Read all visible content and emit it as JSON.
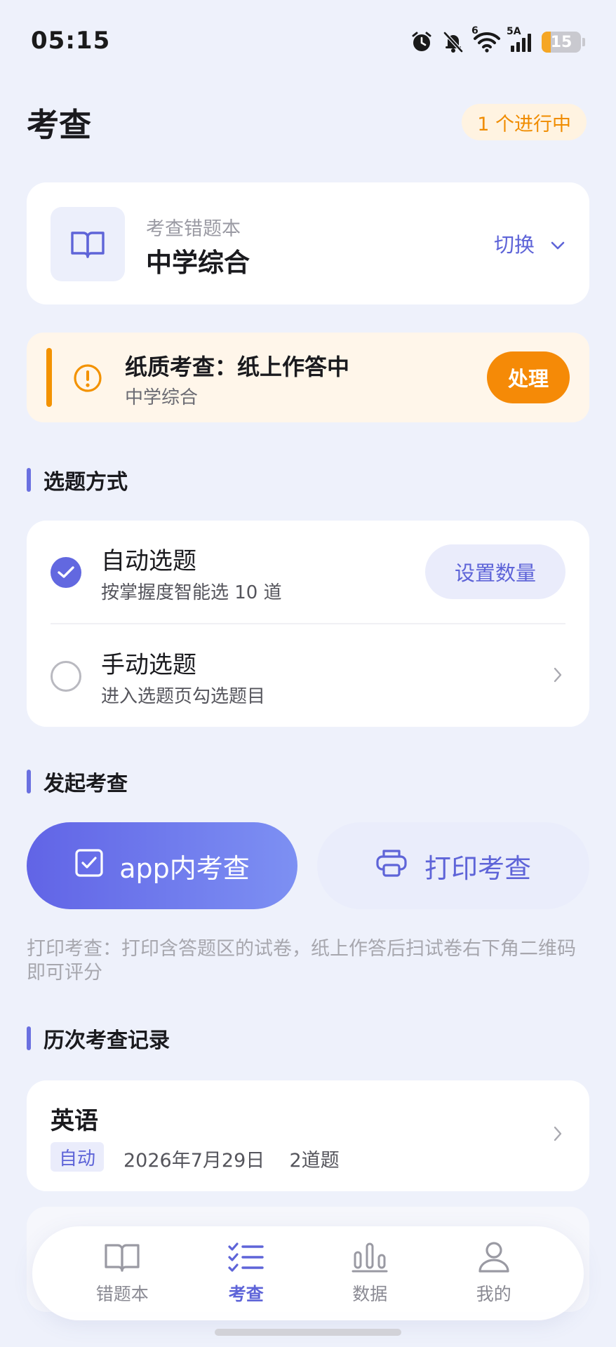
{
  "status_bar": {
    "time": "05:15",
    "network_label": "5A",
    "wifi_label": "6",
    "battery_level": "15"
  },
  "header": {
    "title": "考查",
    "progress_chip": "1 个进行中"
  },
  "notebook": {
    "subtitle": "考查错题本",
    "name": "中学综合",
    "switch_label": "切换"
  },
  "alert": {
    "title": "纸质考查：纸上作答中",
    "subtitle": "中学综合",
    "action_label": "处理"
  },
  "sections": {
    "select_mode": "选题方式",
    "launch": "发起考查",
    "history": "历次考查记录"
  },
  "select_mode": {
    "options": [
      {
        "title": "自动选题",
        "description": "按掌握度智能选 10 道",
        "selected": true,
        "action": "设置数量"
      },
      {
        "title": "手动选题",
        "description": "进入选题页勾选题目",
        "selected": false
      }
    ]
  },
  "launch": {
    "app_button": "app内考查",
    "print_button": "打印考查",
    "hint": "打印考查：打印含答题区的试卷，纸上作答后扫试卷右下角二维码即可评分"
  },
  "history": {
    "records": [
      {
        "subject": "英语",
        "tag": "自动",
        "date": "2026年7月29日",
        "count": "2道题"
      }
    ]
  },
  "bottom_nav": {
    "items": [
      {
        "label": "错题本",
        "active": false
      },
      {
        "label": "考查",
        "active": true
      },
      {
        "label": "数据",
        "active": false
      },
      {
        "label": "我的",
        "active": false
      }
    ]
  },
  "colors": {
    "accent": "#5e64d8",
    "warning": "#f58a07",
    "background": "#eef1fb"
  }
}
